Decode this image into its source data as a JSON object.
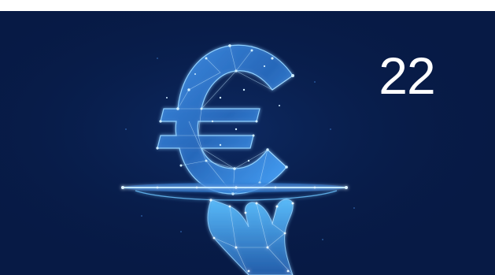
{
  "slide": {
    "page_number": "22"
  },
  "illustration": {
    "icon": "euro-on-tray-hand-icon",
    "colors": {
      "background": "#071a45",
      "glow": "#4aa8ff",
      "highlight": "#bfe6ff",
      "mesh": "#2f7fd6"
    }
  }
}
